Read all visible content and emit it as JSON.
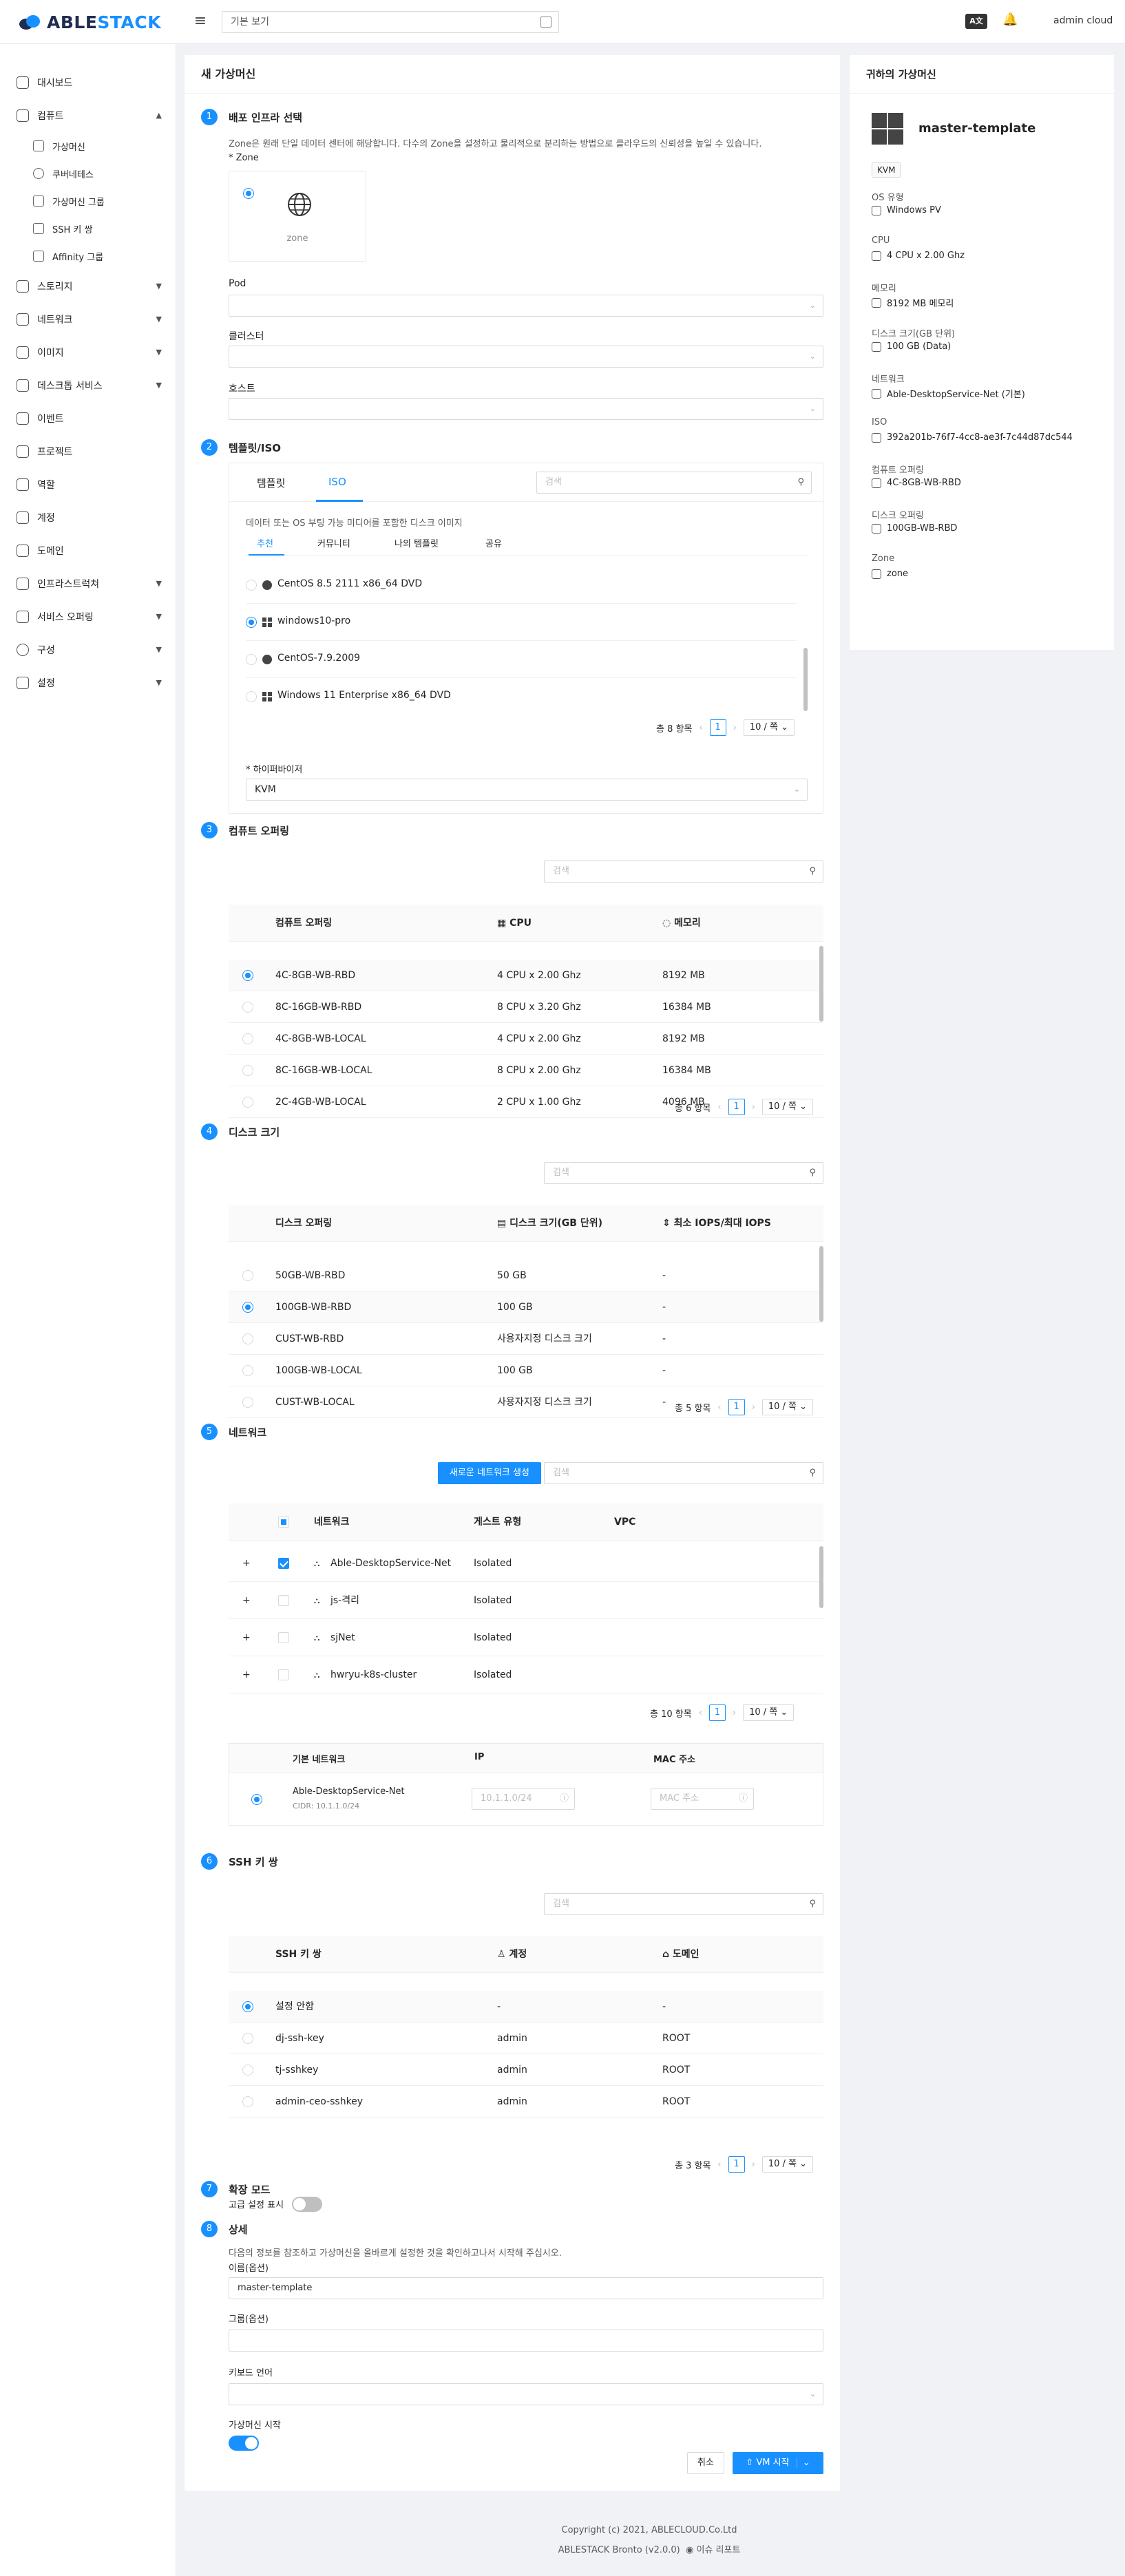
{
  "header": {
    "brand_a": "ABLE",
    "brand_b": "STACK",
    "project_select": "기본 보기",
    "lang_label": "A文",
    "user": "admin cloud"
  },
  "sidebar": {
    "items": [
      {
        "label": "대시보드",
        "icon": "dashboard-icon"
      },
      {
        "label": "컴퓨트",
        "icon": "cloud-icon",
        "expanded": true
      },
      {
        "label": "스토리지",
        "icon": "database-icon"
      },
      {
        "label": "네트워크",
        "icon": "wifi-icon"
      },
      {
        "label": "이미지",
        "icon": "picture-icon"
      },
      {
        "label": "데스크톱 서비스",
        "icon": "cloud-server-icon"
      },
      {
        "label": "이벤트",
        "icon": "schedule-icon"
      },
      {
        "label": "프로젝트",
        "icon": "project-icon"
      },
      {
        "label": "역할",
        "icon": "idcard-icon"
      },
      {
        "label": "계정",
        "icon": "team-icon"
      },
      {
        "label": "도메인",
        "icon": "block-icon"
      },
      {
        "label": "인프라스트럭쳐",
        "icon": "bank-icon"
      },
      {
        "label": "서비스 오퍼링",
        "icon": "shopping-icon"
      },
      {
        "label": "구성",
        "icon": "setting-icon"
      },
      {
        "label": "설정",
        "icon": "tool-icon"
      }
    ],
    "compute_sub": [
      {
        "label": "가상머신",
        "icon": "desktop-icon"
      },
      {
        "label": "쿠버네테스",
        "icon": "kubernetes-icon"
      },
      {
        "label": "가상머신 그룹",
        "icon": "gold-icon"
      },
      {
        "label": "SSH 키 쌍",
        "icon": "key-icon"
      },
      {
        "label": "Affinity 그룹",
        "icon": "swap-icon"
      }
    ]
  },
  "main": {
    "title": "새 가상머신",
    "step1": {
      "num": "1",
      "title": "배포 인프라 선택",
      "desc": "Zone은 원래 단일 데이터 센터에 해당합니다. 다수의 Zone을 설정하고 물리적으로 분리하는 방법으로 클라우드의 신뢰성을 높일 수 있습니다.",
      "zone_label": "* Zone",
      "zone_name": "zone",
      "pod_label": "Pod",
      "cluster_label": "클러스터",
      "host_label": "호스트"
    },
    "step2": {
      "num": "2",
      "title": "템플릿/ISO",
      "tabs": [
        "템플릿",
        "ISO"
      ],
      "search_placeholder": "검색",
      "desc": "데이터 또는 OS 부팅 가능 미디어를 포함한 디스크 이미지",
      "subtabs": [
        "추천",
        "커뮤니티",
        "나의 템플릿",
        "공유"
      ],
      "items": [
        {
          "name": "CentOS 8.5 2111 x86_64 DVD",
          "selected": false
        },
        {
          "name": "windows10-pro",
          "selected": true
        },
        {
          "name": "CentOS-7.9.2009",
          "selected": false
        },
        {
          "name": "Windows 11 Enterprise x86_64 DVD",
          "selected": false
        }
      ],
      "total": "총 8 항목",
      "page": "1",
      "page_size": "10 / 쪽",
      "hypervisor_label": "* 하이퍼바이저",
      "hypervisor": "KVM"
    },
    "step3": {
      "num": "3",
      "title": "컴퓨트 오퍼링",
      "search_placeholder": "검색",
      "headers": [
        "컴퓨트 오퍼링",
        "CPU",
        "메모리"
      ],
      "rows": [
        [
          "4C-8GB-WB-RBD",
          "4 CPU x 2.00 Ghz",
          "8192 MB"
        ],
        [
          "8C-16GB-WB-RBD",
          "8 CPU x 3.20 Ghz",
          "16384 MB"
        ],
        [
          "4C-8GB-WB-LOCAL",
          "4 CPU x 2.00 Ghz",
          "8192 MB"
        ],
        [
          "8C-16GB-WB-LOCAL",
          "8 CPU x 2.00 Ghz",
          "16384 MB"
        ],
        [
          "2C-4GB-WB-LOCAL",
          "2 CPU x 1.00 Ghz",
          "4096 MB"
        ]
      ],
      "total": "총 6 항목",
      "page": "1",
      "page_size": "10 / 쪽"
    },
    "step4": {
      "num": "4",
      "title": "디스크 크기",
      "search_placeholder": "검색",
      "headers": [
        "디스크 오퍼링",
        "디스크 크기(GB 단위)",
        "최소 IOPS/최대 IOPS"
      ],
      "rows": [
        [
          "50GB-WB-RBD",
          "50 GB",
          "-"
        ],
        [
          "100GB-WB-RBD",
          "100 GB",
          "-"
        ],
        [
          "CUST-WB-RBD",
          "사용자지정 디스크 크기",
          "-"
        ],
        [
          "100GB-WB-LOCAL",
          "100 GB",
          "-"
        ],
        [
          "CUST-WB-LOCAL",
          "사용자지정 디스크 크기",
          "-"
        ]
      ],
      "total": "총 5 항목",
      "page": "1",
      "page_size": "10 / 쪽"
    },
    "step5": {
      "num": "5",
      "title": "네트워크",
      "new_btn": "새로운 네트워크 생성",
      "search_placeholder": "검색",
      "headers": [
        "네트워크",
        "게스트 유형",
        "VPC"
      ],
      "rows": [
        [
          "Able-DesktopService-Net",
          "Isolated",
          ""
        ],
        [
          "js-격리",
          "Isolated",
          ""
        ],
        [
          "sjNet",
          "Isolated",
          ""
        ],
        [
          "hwryu-k8s-cluster",
          "Isolated",
          ""
        ]
      ],
      "total": "총 10 항목",
      "page": "1",
      "page_size": "10 / 쪽",
      "default_headers": [
        "기본 네트워크",
        "IP",
        "MAC 주소"
      ],
      "default_net": "Able-DesktopService-Net",
      "cidr": "CIDR: 10.1.1.0/24",
      "ip_placeholder": "10.1.1.0/24",
      "mac_placeholder": "MAC 주소"
    },
    "step6": {
      "num": "6",
      "title": "SSH 키 쌍",
      "search_placeholder": "검색",
      "headers": [
        "SSH 키 쌍",
        "계정",
        "도메인"
      ],
      "rows": [
        [
          "설정 안함",
          "-",
          "-"
        ],
        [
          "dj-ssh-key",
          "admin",
          "ROOT"
        ],
        [
          "tj-sshkey",
          "admin",
          "ROOT"
        ],
        [
          "admin-ceo-sshkey",
          "admin",
          "ROOT"
        ]
      ],
      "total": "총 3 항목",
      "page": "1",
      "page_size": "10 / 쪽"
    },
    "step7": {
      "num": "7",
      "title": "확장 모드",
      "toggle_label": "고급 설정 표시"
    },
    "step8": {
      "num": "8",
      "title": "상세",
      "desc": "다음의 정보를 참조하고 가상머신을 올바르게 설정한 것을 확인하고나서 시작해 주십시오.",
      "name_label": "이름(옵션)",
      "name_value": "master-template",
      "group_label": "그룹(옵션)",
      "keyboard_label": "키보드 언어",
      "start_label": "가상머신 시작"
    },
    "cancel": "취소",
    "submit": "VM 시작"
  },
  "summary": {
    "title": "귀하의 가상머신",
    "vm_name": "master-template",
    "hypervisor": "KVM",
    "fields": [
      {
        "label": "OS 유형",
        "value": "Windows PV",
        "icon": "windows-icon"
      },
      {
        "label": "CPU",
        "value": "4 CPU x 2.00 Ghz",
        "icon": "appstore-icon"
      },
      {
        "label": "메모리",
        "value": "8192 MB 메모리",
        "icon": "bulb-icon"
      },
      {
        "label": "디스크 크기(GB 단위)",
        "value": "100 GB (Data)",
        "icon": "hdd-icon"
      },
      {
        "label": "네트워크",
        "value": "Able-DesktopService-Net (기본)",
        "icon": "link-icon"
      },
      {
        "label": "ISO",
        "value": "392a201b-76f7-4cc8-ae3f-7c44d87dc544",
        "icon": "disk-icon"
      },
      {
        "label": "컴퓨트 오퍼링",
        "value": "4C-8GB-WB-RBD",
        "icon": "cloud-icon"
      },
      {
        "label": "디스크 오퍼링",
        "value": "100GB-WB-RBD",
        "icon": "hdd-icon"
      },
      {
        "label": "Zone",
        "value": "zone",
        "icon": "global-icon"
      }
    ]
  },
  "footer": {
    "copyright": "Copyright (c) 2021, ABLECLOUD.Co.Ltd",
    "version": "ABLESTACK Bronto (v2.0.0)",
    "report": "이슈 리포트"
  },
  "colors": {
    "primary": "#1890ff",
    "brand_dark": "#1f2d50"
  }
}
